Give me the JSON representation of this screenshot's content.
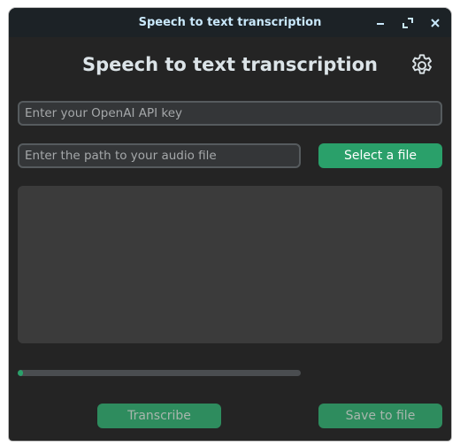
{
  "window": {
    "title": "Speech to text transcription",
    "controls": [
      "minimize-icon",
      "maximize-icon",
      "close-icon"
    ]
  },
  "header": {
    "title": "Speech to text transcription",
    "settings_icon": "gear-icon"
  },
  "api_key": {
    "value": "",
    "placeholder": "Enter your OpenAI API key"
  },
  "audio_path": {
    "value": "",
    "placeholder": "Enter the path to your audio file"
  },
  "buttons": {
    "select_file": "Select a file",
    "transcribe": "Transcribe",
    "save": "Save to file"
  },
  "transcript": {
    "text": ""
  },
  "progress": {
    "fraction": 0.02
  },
  "colors": {
    "accent": "#2aa06a",
    "window_bg": "#242424",
    "titlebar_bg": "#1c2226",
    "field_bg": "#343638",
    "field_border": "#565b5e",
    "textbox_bg": "#3b3b3b"
  }
}
